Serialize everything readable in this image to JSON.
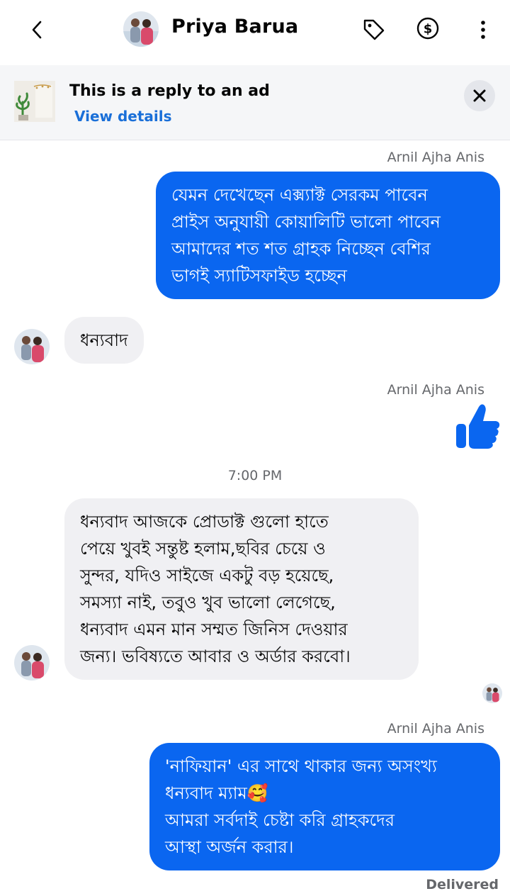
{
  "header": {
    "contact_name": "Priya Barua",
    "icons": [
      "back-chevron-icon",
      "tag-icon",
      "dollar-icon",
      "more-vertical-icon"
    ]
  },
  "ad_banner": {
    "title": "This is a reply to an ad",
    "link": "View details",
    "close_icon": "close-icon"
  },
  "colors": {
    "outgoing_bubble": "#0a66f0",
    "incoming_bubble": "#f0f0f3",
    "link": "#1a6fd8",
    "secondary_text": "#65676b"
  },
  "messages": [
    {
      "direction": "outgoing",
      "sender": "Arnil Ajha Anis",
      "lines": [
        "যেমন দেখেছেন এক্স্যাক্ট সেরকম পাবেন",
        "প্রাইস অনুযায়ী কোয়ালিটি ভালো পাবেন",
        "আমাদের শত শত গ্রাহক নিচ্ছেন বেশির",
        "ভাগই স্যাটিসফাইড হচ্ছেন"
      ]
    },
    {
      "direction": "incoming",
      "lines": [
        "ধন্যবাদ"
      ]
    },
    {
      "direction": "outgoing",
      "sender": "Arnil Ajha Anis",
      "sticker": "thumbs-up-icon"
    },
    {
      "direction": "incoming",
      "timestamp": "7:00 PM",
      "lines": [
        "ধন্যবাদ আজকে প্রোডাক্ট গুলো হাতে",
        "পেয়ে খুবই সন্তুষ্ট হলাম,ছবির চেয়ে ও",
        "সুন্দর, যদিও সাইজে একটু বড় হয়েছে,",
        "সমস্যা নাই, তবুও খুব ভালো লেগেছে,",
        "ধন্যবাদ এমন মান সম্মত জিনিস দেওয়ার",
        "জন্য। ভবিষ্যতে আবার ও অর্ডার করবো।"
      ]
    },
    {
      "direction": "outgoing",
      "sender": "Arnil Ajha Anis",
      "lines": [
        "'নাফিয়ান' এর সাথে থাকার জন্য অসংখ্য",
        "ধন্যবাদ ম্যাম🥰",
        "আমরা সর্বদাই চেষ্টা করি গ্রাহকদের",
        "আস্থা অর্জন করার।"
      ],
      "status": "Delivered"
    }
  ]
}
